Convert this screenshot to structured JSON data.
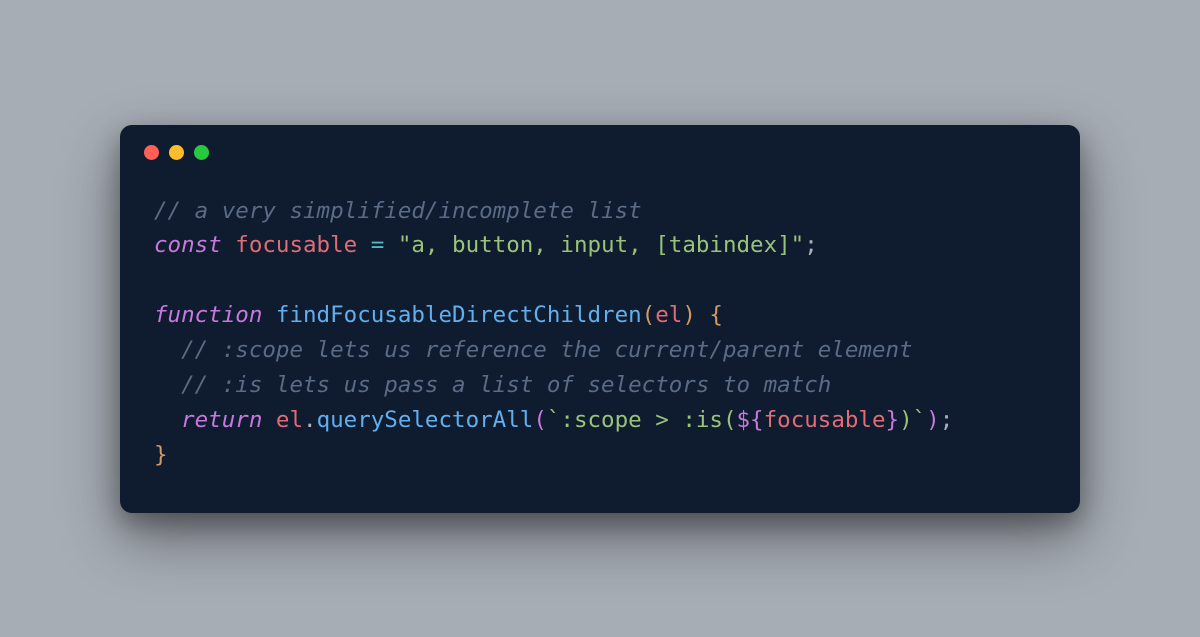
{
  "code": {
    "lines": [
      {
        "indent": 0,
        "tokens": [
          {
            "t": "comment",
            "v": "// a very simplified/incomplete list"
          }
        ]
      },
      {
        "indent": 0,
        "tokens": [
          {
            "t": "keyword",
            "v": "const"
          },
          {
            "t": "plain",
            "v": " "
          },
          {
            "t": "ident",
            "v": "focusable"
          },
          {
            "t": "plain",
            "v": " "
          },
          {
            "t": "op",
            "v": "="
          },
          {
            "t": "plain",
            "v": " "
          },
          {
            "t": "string",
            "v": "\"a, button, input, [tabindex]\""
          },
          {
            "t": "punc",
            "v": ";"
          }
        ]
      },
      {
        "indent": 0,
        "tokens": []
      },
      {
        "indent": 0,
        "tokens": [
          {
            "t": "keyword",
            "v": "function"
          },
          {
            "t": "plain",
            "v": " "
          },
          {
            "t": "func",
            "v": "findFocusableDirectChildren"
          },
          {
            "t": "punc-gold",
            "v": "("
          },
          {
            "t": "ident",
            "v": "el"
          },
          {
            "t": "punc-gold",
            "v": ")"
          },
          {
            "t": "plain",
            "v": " "
          },
          {
            "t": "punc-gold",
            "v": "{"
          }
        ]
      },
      {
        "indent": 1,
        "tokens": [
          {
            "t": "comment",
            "v": "// :scope lets us reference the current/parent element"
          }
        ]
      },
      {
        "indent": 1,
        "tokens": [
          {
            "t": "comment",
            "v": "// :is lets us pass a list of selectors to match"
          }
        ]
      },
      {
        "indent": 1,
        "tokens": [
          {
            "t": "keyword",
            "v": "return"
          },
          {
            "t": "plain",
            "v": " "
          },
          {
            "t": "ident",
            "v": "el"
          },
          {
            "t": "punc",
            "v": "."
          },
          {
            "t": "func",
            "v": "querySelectorAll"
          },
          {
            "t": "paren-purple",
            "v": "("
          },
          {
            "t": "tmpl",
            "v": "`:scope > :is("
          },
          {
            "t": "interp-brace",
            "v": "${"
          },
          {
            "t": "interp",
            "v": "focusable"
          },
          {
            "t": "interp-brace",
            "v": "}"
          },
          {
            "t": "tmpl",
            "v": ")`"
          },
          {
            "t": "paren-purple",
            "v": ")"
          },
          {
            "t": "punc",
            "v": ";"
          }
        ]
      },
      {
        "indent": 0,
        "tokens": [
          {
            "t": "punc-gold",
            "v": "}"
          }
        ]
      }
    ]
  },
  "colors": {
    "background_page": "#a7adb5",
    "background_editor": "#0f1b2e",
    "dot_red": "#ff5f56",
    "dot_yellow": "#ffbd2e",
    "dot_green": "#27c93f"
  }
}
